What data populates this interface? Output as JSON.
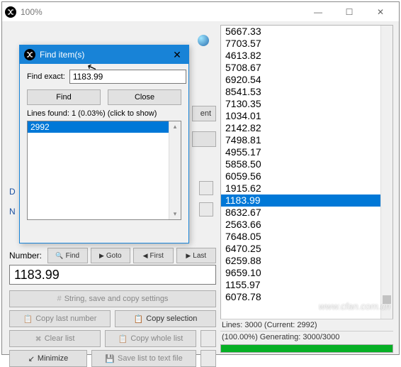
{
  "window": {
    "title": "100%"
  },
  "dialog": {
    "title": "Find item(s)",
    "find_exact_label": "Find exact:",
    "find_exact_value": "1183.99",
    "find_btn": "Find",
    "close_btn": "Close",
    "status": "Lines found: 1 (0.03%) (click to show)",
    "results": [
      "2992"
    ]
  },
  "behind": {
    "ent_btn_suffix": "ent",
    "letter_d": "D",
    "letter_n": "N"
  },
  "numrow": {
    "label": "Number:",
    "find": "Find",
    "goto": "Goto",
    "first": "First",
    "last": "Last"
  },
  "number_value": "1183.99",
  "buttons": {
    "string_settings": "String, save and copy settings",
    "copy_last": "Copy last number",
    "copy_sel": "Copy selection",
    "clear_list": "Clear list",
    "copy_whole": "Copy whole list",
    "minimize": "Minimize",
    "save_txt": "Save list to text file"
  },
  "list": {
    "items": [
      "5667.33",
      "7703.57",
      "4613.82",
      "5708.67",
      "6920.54",
      "8541.53",
      "7130.35",
      "1034.01",
      "2142.82",
      "7498.81",
      "4955.17",
      "5858.50",
      "6059.56",
      "1915.62",
      "1183.99",
      "8632.67",
      "2563.66",
      "7648.05",
      "6470.25",
      "6259.88",
      "9659.10",
      "1155.97",
      "6078.78"
    ],
    "selected_index": 14
  },
  "status": {
    "line1": "Lines: 3000 (Current: 2992)",
    "line2": "(100.00%) Generating: 3000/3000"
  },
  "watermark": "www.cfan.com.cn",
  "icons": {
    "shuffle": "✕",
    "minimize_win": "—",
    "maximize_win": "☐",
    "close_win": "✕",
    "search": "🔍",
    "goto_arrow": "▶",
    "first_arrow": "◀",
    "last_arrow": "▶",
    "hash": "#",
    "copy": "📋",
    "clear": "✖",
    "save": "💾",
    "min_app": "↙"
  }
}
